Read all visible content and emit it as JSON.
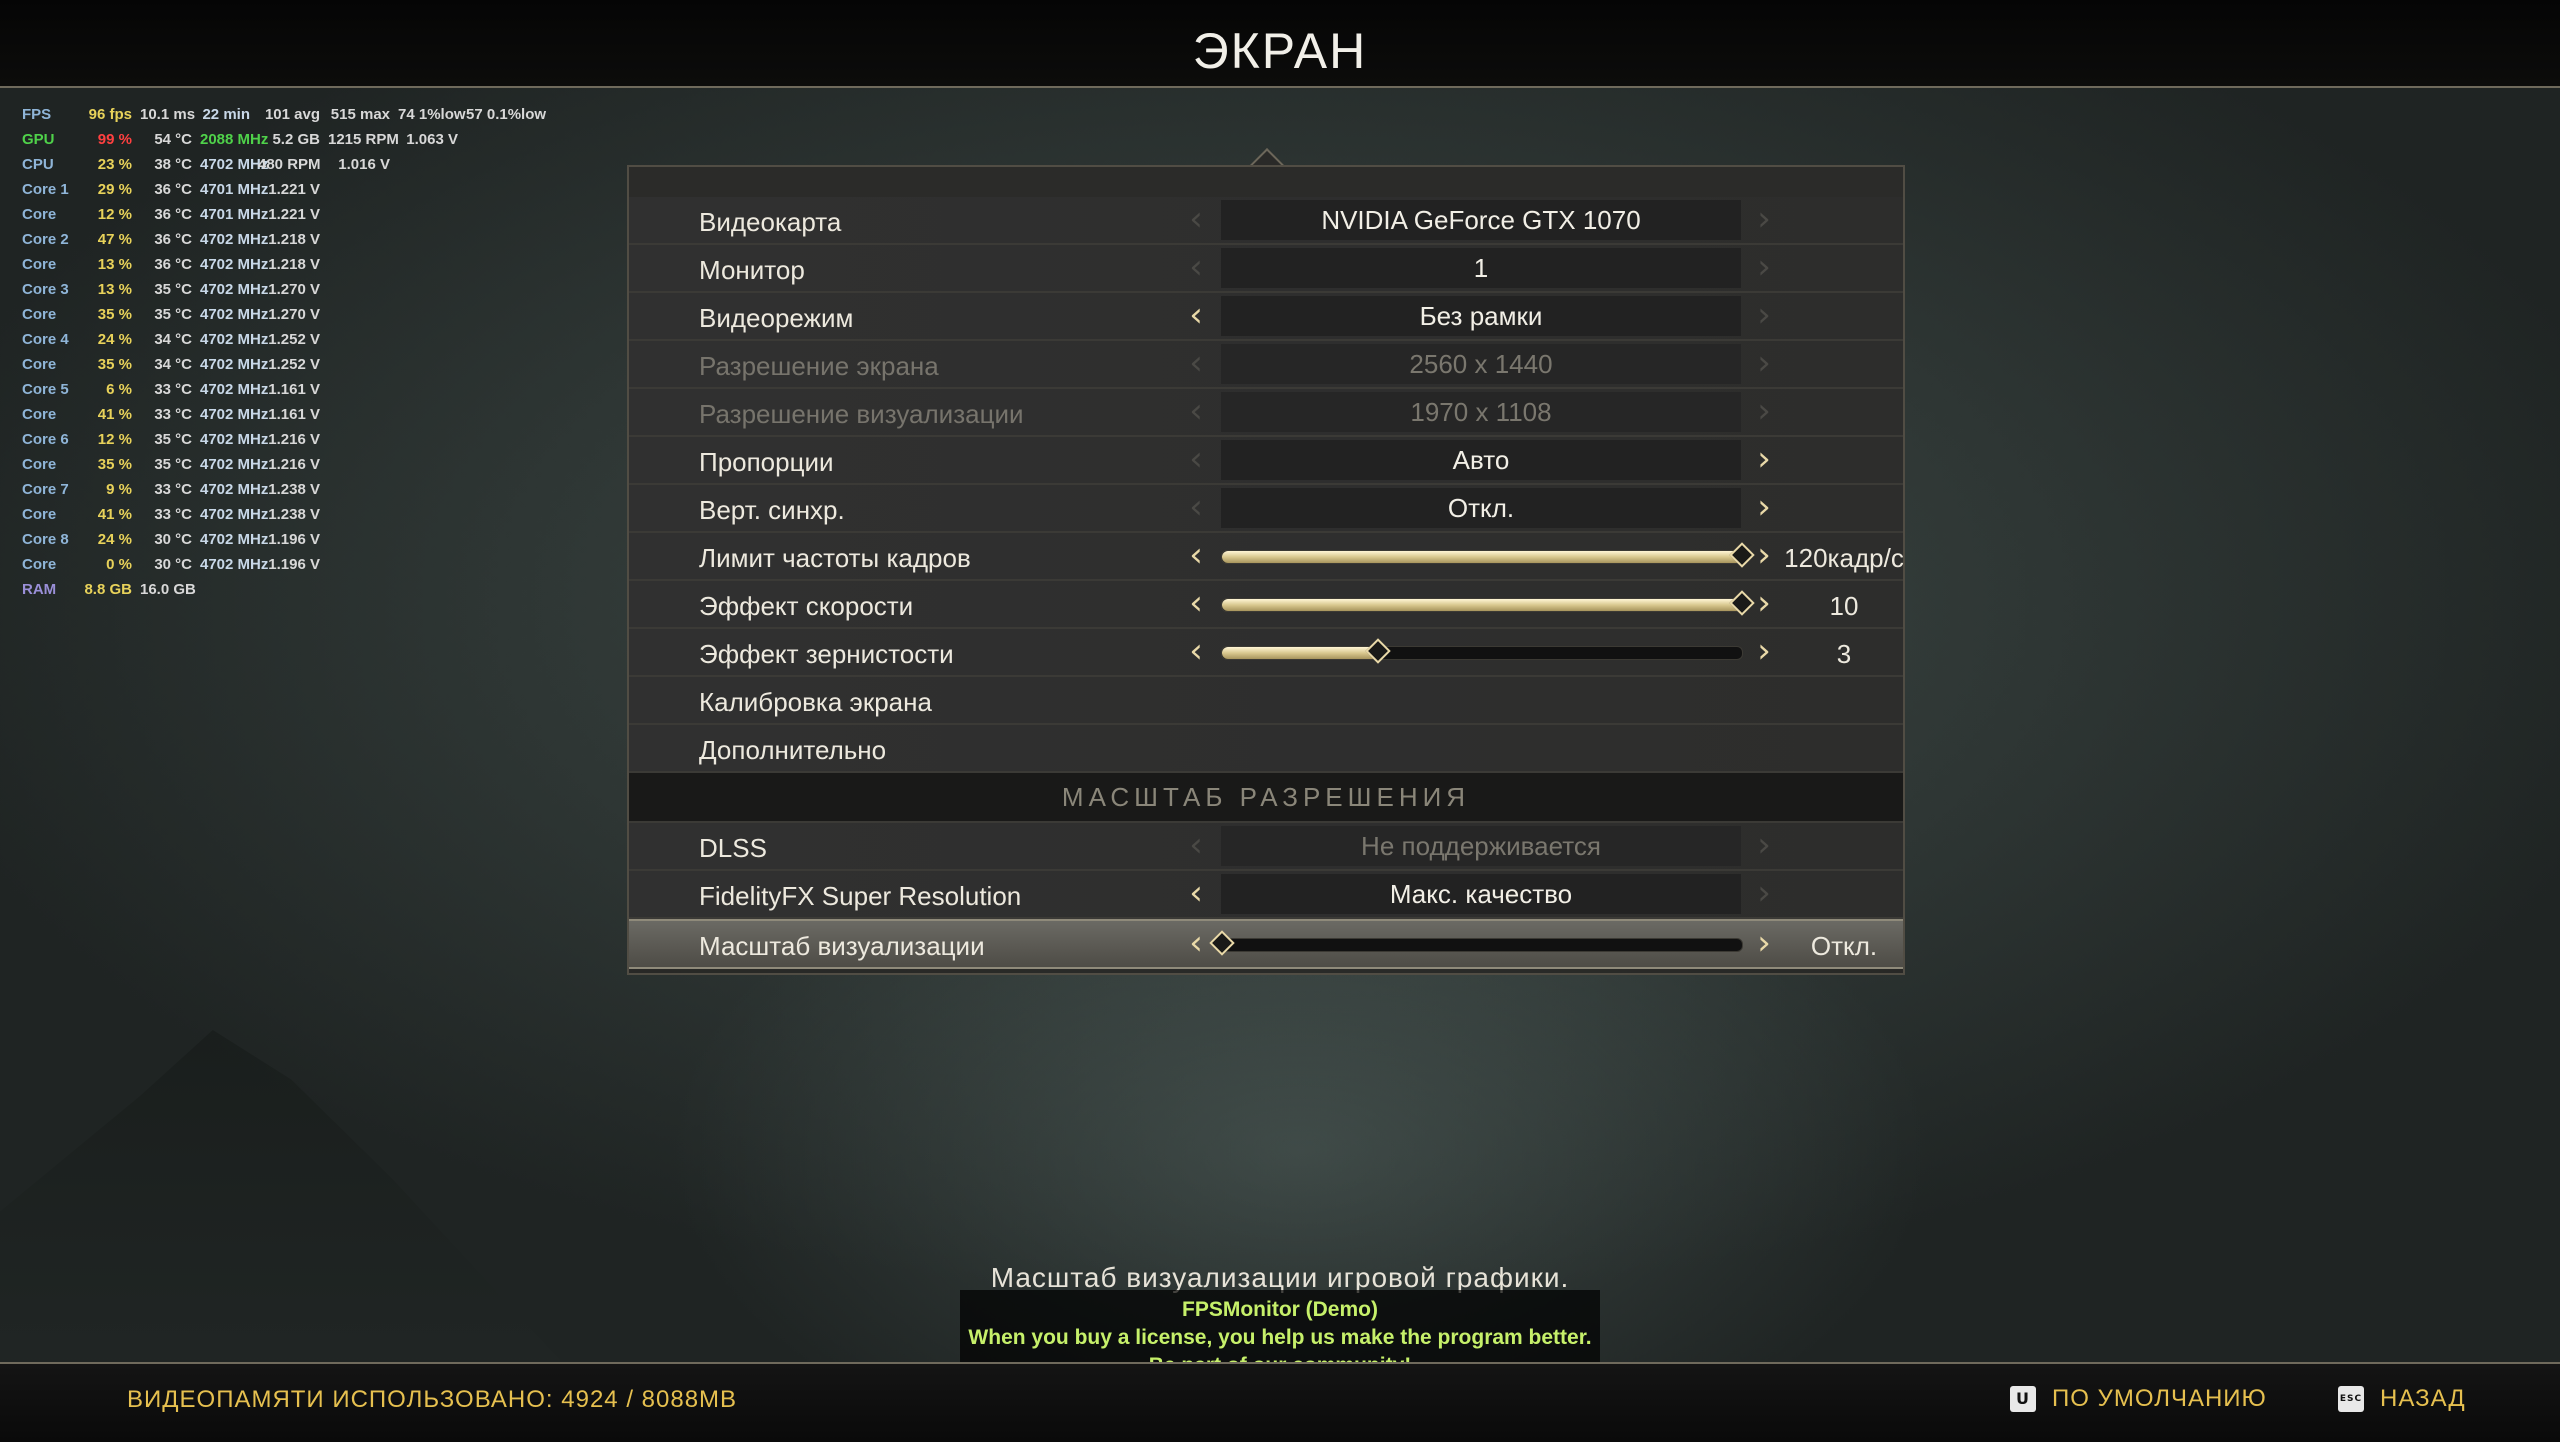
{
  "title": "ЭКРАН",
  "fps_monitor": {
    "rows": [
      {
        "cols": [
          "FPS",
          "96 fps",
          "10.1 ms",
          "22 min",
          "101 avg",
          "515 max",
          "74 1%low",
          "57 0.1%low"
        ]
      },
      {
        "cols": [
          "GPU",
          "99 %",
          "54 °C",
          "2088 MHz",
          "5.2 GB",
          "1215 RPM",
          "1.063 V",
          ""
        ]
      },
      {
        "cols": [
          "CPU",
          "23 %",
          "38 °C",
          "4702 MHz",
          "480 RPM",
          "1.016 V",
          "",
          ""
        ]
      },
      {
        "cols": [
          "Core 1",
          "29 %",
          "36 °C",
          "4701 MHz",
          "1.221 V",
          "",
          "",
          ""
        ]
      },
      {
        "cols": [
          "Core",
          "12 %",
          "36 °C",
          "4701 MHz",
          "1.221 V",
          "",
          "",
          ""
        ]
      },
      {
        "cols": [
          "Core 2",
          "47 %",
          "36 °C",
          "4702 MHz",
          "1.218 V",
          "",
          "",
          ""
        ]
      },
      {
        "cols": [
          "Core",
          "13 %",
          "36 °C",
          "4702 MHz",
          "1.218 V",
          "",
          "",
          ""
        ]
      },
      {
        "cols": [
          "Core 3",
          "13 %",
          "35 °C",
          "4702 MHz",
          "1.270 V",
          "",
          "",
          ""
        ]
      },
      {
        "cols": [
          "Core",
          "35 %",
          "35 °C",
          "4702 MHz",
          "1.270 V",
          "",
          "",
          ""
        ]
      },
      {
        "cols": [
          "Core 4",
          "24 %",
          "34 °C",
          "4702 MHz",
          "1.252 V",
          "",
          "",
          ""
        ]
      },
      {
        "cols": [
          "Core",
          "35 %",
          "34 °C",
          "4702 MHz",
          "1.252 V",
          "",
          "",
          ""
        ]
      },
      {
        "cols": [
          "Core 5",
          "6 %",
          "33 °C",
          "4702 MHz",
          "1.161 V",
          "",
          "",
          ""
        ]
      },
      {
        "cols": [
          "Core",
          "41 %",
          "33 °C",
          "4702 MHz",
          "1.161 V",
          "",
          "",
          ""
        ]
      },
      {
        "cols": [
          "Core 6",
          "12 %",
          "35 °C",
          "4702 MHz",
          "1.216 V",
          "",
          "",
          ""
        ]
      },
      {
        "cols": [
          "Core",
          "35 %",
          "35 °C",
          "4702 MHz",
          "1.216 V",
          "",
          "",
          ""
        ]
      },
      {
        "cols": [
          "Core 7",
          "9 %",
          "33 °C",
          "4702 MHz",
          "1.238 V",
          "",
          "",
          ""
        ]
      },
      {
        "cols": [
          "Core",
          "41 %",
          "33 °C",
          "4702 MHz",
          "1.238 V",
          "",
          "",
          ""
        ]
      },
      {
        "cols": [
          "Core 8",
          "24 %",
          "30 °C",
          "4702 MHz",
          "1.196 V",
          "",
          "",
          ""
        ]
      },
      {
        "cols": [
          "Core",
          "0 %",
          "30 °C",
          "4702 MHz",
          "1.196 V",
          "",
          "",
          ""
        ]
      },
      {
        "cols": [
          "RAM",
          "8.8 GB",
          "16.0 GB",
          "",
          "",
          "",
          "",
          ""
        ]
      }
    ]
  },
  "settings": {
    "gpu": {
      "label": "Видеокарта",
      "value": "NVIDIA GeForce GTX 1070"
    },
    "monitor": {
      "label": "Монитор",
      "value": "1"
    },
    "video_mode": {
      "label": "Видеорежим",
      "value": "Без рамки"
    },
    "screen_resolution": {
      "label": "Разрешение экрана",
      "value": "2560 x 1440"
    },
    "render_resolution": {
      "label": "Разрешение визуализации",
      "value": "1970 x 1108"
    },
    "aspect": {
      "label": "Пропорции",
      "value": "Авто"
    },
    "vsync": {
      "label": "Верт. синхр.",
      "value": "Откл."
    },
    "frame_limit": {
      "label": "Лимит частоты кадров",
      "value": "120кадр/с",
      "level": 1.0
    },
    "motion_blur": {
      "label": "Эффект скорости",
      "value": "10",
      "level": 1.0
    },
    "film_grain": {
      "label": "Эффект зернистости",
      "value": "3",
      "level": 0.3
    },
    "calibration": {
      "label": "Калибровка экрана"
    },
    "advanced": {
      "label": "Дополнительно"
    },
    "section_scale": "МАСШТАБ РАЗРЕШЕНИЯ",
    "dlss": {
      "label": "DLSS",
      "value": "Не поддерживается"
    },
    "fsr": {
      "label": "FidelityFX Super Resolution",
      "value": "Макс. качество"
    },
    "render_scale": {
      "label": "Масштаб визуализации",
      "value": "Откл.",
      "level": 0.0
    }
  },
  "description": "Масштаб визуализации игровой графики.",
  "watermark": {
    "line1": "FPSMonitor (Demo)",
    "line2": "When you buy a license, you help us make the program better.",
    "line3": "Be part of our community!"
  },
  "footer": {
    "vram": "ВИДЕОПАМЯТИ ИСПОЛЬЗОВАНО: 4924 / 8088MB",
    "default_key": "U",
    "default_label": "ПО УМОЛЧАНИЮ",
    "back_key": "ESC",
    "back_label": "НАЗАД"
  },
  "icons": {
    "left_arrow": "chevron-left-icon",
    "right_arrow": "chevron-right-icon",
    "knob": "diamond-icon"
  },
  "colors": {
    "accent": "#e6c04f",
    "slider_fill": "#d9c88f",
    "arrow": "#e9d9a8"
  }
}
